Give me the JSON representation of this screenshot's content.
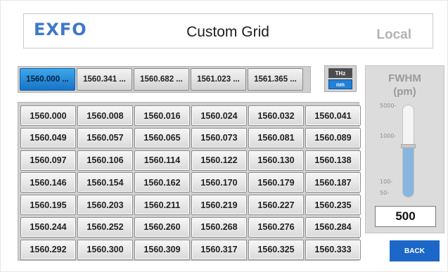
{
  "header": {
    "logo": "EXFO",
    "title": "Custom Grid",
    "mode": "Local"
  },
  "tabs": [
    {
      "label": "1560.000 ...",
      "active": true
    },
    {
      "label": "1560.341 ...",
      "active": false
    },
    {
      "label": "1560.682 ...",
      "active": false
    },
    {
      "label": "1561.023 ...",
      "active": false
    },
    {
      "label": "1561.365 ...",
      "active": false
    }
  ],
  "units": {
    "thz": "THz",
    "nm": "nm",
    "selected": "nm"
  },
  "grid": {
    "values": [
      "1560.000",
      "1560.008",
      "1560.016",
      "1560.024",
      "1560.032",
      "1560.041",
      "1560.049",
      "1560.057",
      "1560.065",
      "1560.073",
      "1560.081",
      "1560.089",
      "1560.097",
      "1560.106",
      "1560.114",
      "1560.122",
      "1560.130",
      "1560.138",
      "1560.146",
      "1560.154",
      "1560.162",
      "1560.170",
      "1560.179",
      "1560.187",
      "1560.195",
      "1560.203",
      "1560.211",
      "1560.219",
      "1560.227",
      "1560.235",
      "1560.244",
      "1560.252",
      "1560.260",
      "1560.268",
      "1560.276",
      "1560.284",
      "1560.292",
      "1560.300",
      "1560.309",
      "1560.317",
      "1560.325",
      "1560.333"
    ]
  },
  "fwhm": {
    "title_line1": "FWHM",
    "title_line2": "(pm)",
    "ticks": [
      "5000-",
      "1000-",
      "100-",
      "50-"
    ],
    "value": "500",
    "slider_level": 0.55
  },
  "back_label": "BACK",
  "colors": {
    "accent": "#1d67c8",
    "active_tab": "#2a8ddc",
    "logo": "#3d78c8"
  }
}
